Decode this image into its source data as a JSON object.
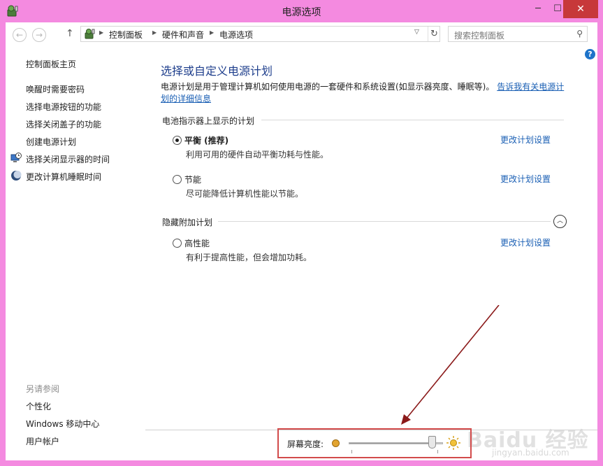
{
  "window": {
    "title": "电源选项",
    "minimize_glyph": "─",
    "maximize_glyph": "☐",
    "close_glyph": "✕"
  },
  "nav": {
    "back_glyph": "←",
    "forward_glyph": "→",
    "up_glyph": "↑",
    "breadcrumbs": [
      "控制面板",
      "硬件和声音",
      "电源选项"
    ],
    "crumb_separator": "▶",
    "dropdown_glyph": "▽",
    "refresh_glyph": "↻",
    "search_placeholder": "搜索控制面板",
    "search_glyph": "⚲",
    "help_glyph": "?"
  },
  "sidebar": {
    "home": "控制面板主页",
    "items": [
      {
        "label": "唤醒时需要密码",
        "icon": ""
      },
      {
        "label": "选择电源按钮的功能",
        "icon": ""
      },
      {
        "label": "选择关闭盖子的功能",
        "icon": ""
      },
      {
        "label": "创建电源计划",
        "icon": ""
      },
      {
        "label": "选择关闭显示器的时间",
        "icon": "monitor-clock-icon"
      },
      {
        "label": "更改计算机睡眠时间",
        "icon": "moon-icon"
      }
    ],
    "see_also": "另请参阅",
    "see_also_items": [
      "个性化",
      "Windows 移动中心",
      "用户帐户"
    ]
  },
  "main": {
    "title": "选择或自定义电源计划",
    "description": "电源计划是用于管理计算机如何使用电源的一套硬件和系统设置(如显示器亮度、睡眠等)。",
    "description_link": "告诉我有关电源计划的详细信息",
    "battery_section": "电池指示器上显示的计划",
    "hidden_section": "隐藏附加计划",
    "collapse_glyph": "︿",
    "plans": [
      {
        "name": "平衡 (推荐)",
        "desc": "利用可用的硬件自动平衡功耗与性能。",
        "link": "更改计划设置",
        "selected": true
      },
      {
        "name": "节能",
        "desc": "尽可能降低计算机性能以节能。",
        "link": "更改计划设置",
        "selected": false
      },
      {
        "name": "高性能",
        "desc": "有利于提高性能，但会增加功耗。",
        "link": "更改计划设置",
        "selected": false
      }
    ]
  },
  "brightness": {
    "label": "屏幕亮度:",
    "value_fraction": 0.92
  },
  "watermark": {
    "brand": "Baidu 经验",
    "sub": "jingyan.baidu.com"
  },
  "colors": {
    "window_frame": "#f48ae0",
    "close_button": "#c7383a",
    "link": "#1a5fb4",
    "title_blue": "#1e3e8c",
    "highlight_box": "#d24b4b",
    "arrow": "#8b1a1a"
  }
}
